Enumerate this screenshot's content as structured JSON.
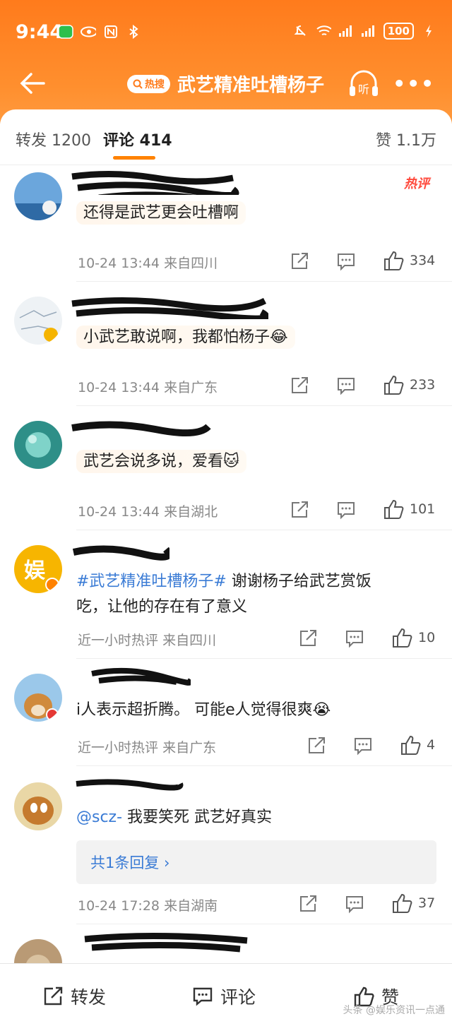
{
  "status_bar": {
    "time": "9:44",
    "battery": "100"
  },
  "nav": {
    "hot_tag": "热搜",
    "title": "武艺精准吐槽杨子"
  },
  "tabs": {
    "repost": "转发 1200",
    "comment": "评论 414",
    "like": "赞 1.1万"
  },
  "comments": [
    {
      "text": "还得是武艺更会吐槽啊",
      "time": "10-24 13:44",
      "location": "来自四川",
      "likes": "334",
      "badge": "热评"
    },
    {
      "text": "小武艺敢说啊，我都怕杨子😂",
      "time": "10-24 13:44",
      "location": "来自广东",
      "likes": "233"
    },
    {
      "text": "武艺会说多说，爱看🐱",
      "time": "10-24 13:44",
      "location": "来自湖北",
      "likes": "101"
    },
    {
      "topic": "#武艺精准吐槽杨子#",
      "text_after_topic": " 谢谢杨子给武艺赏饭",
      "text_line2": "吃，让他的存在有了意义",
      "time": "近一小时热评",
      "location": "来自四川",
      "likes": "10"
    },
    {
      "text": "i人表示超折腾。 可能e人觉得很爽😭",
      "time": "近一小时热评",
      "location": "来自广东",
      "likes": "4"
    },
    {
      "mention": "@scz-",
      "text_after_mention": " 我要笑死 武艺好真实",
      "reply_summary": "共1条回复 ›",
      "time": "10-24 17:28",
      "location": "来自湖南",
      "likes": "37"
    }
  ],
  "bottom": {
    "repost": "转发",
    "comment": "评论",
    "like": "赞"
  },
  "watermark": "头条 @娱乐资讯一点通",
  "colors": {
    "accent": "#ff8200",
    "link": "#3a7bd5"
  }
}
